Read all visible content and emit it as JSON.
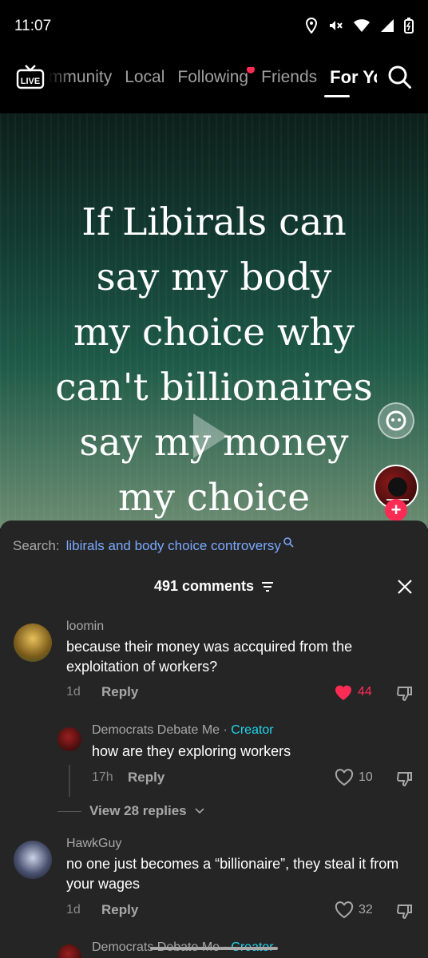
{
  "status": {
    "time": "11:07"
  },
  "nav": {
    "tabs": [
      {
        "label": "Community"
      },
      {
        "label": "Local"
      },
      {
        "label": "Following"
      },
      {
        "label": "Friends"
      },
      {
        "label": "For You"
      }
    ],
    "live_label": "LIVE"
  },
  "video": {
    "caption_lines": [
      "If Libirals can",
      "say my body",
      "my choice why",
      "can't billionaires",
      "say my money",
      "my choice"
    ]
  },
  "sheet": {
    "search_label": "Search:",
    "search_query": "libirals and body choice controversy",
    "comments_count": "491 comments",
    "comments": [
      {
        "user": "loomin",
        "text": "because their money was accquired from the exploitation of workers?",
        "age": "1d",
        "reply_label": "Reply",
        "likes": "44"
      },
      {
        "user": "Democrats Debate Me",
        "creator_tag": "Creator",
        "text": "how are they exploring workers",
        "age": "17h",
        "reply_label": "Reply",
        "likes": "10"
      },
      {
        "user": "HawkGuy",
        "text": "no one just becomes a “billionaire”, they steal it from your wages",
        "age": "1d",
        "reply_label": "Reply",
        "likes": "32"
      },
      {
        "user": "Democrats Debate Me",
        "creator_tag": "Creator"
      }
    ],
    "view_replies": "View 28 replies"
  },
  "colors": {
    "accent": "#fe2c55",
    "creator": "#20d5ec",
    "link": "#7aa9ff"
  }
}
